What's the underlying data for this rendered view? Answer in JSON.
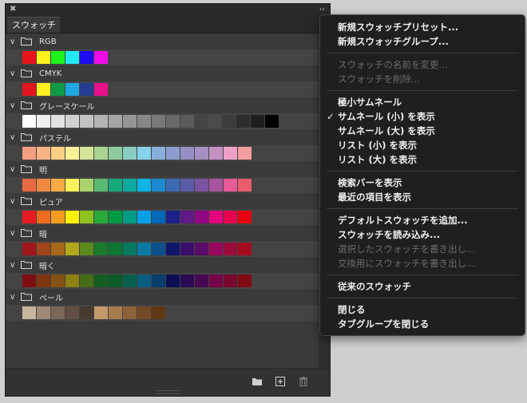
{
  "panel": {
    "tab_label": "スウォッチ",
    "close_glyph": "✖",
    "collapse_glyph": "‹‹"
  },
  "groups": [
    {
      "name": "RGB",
      "colors": [
        "#e8141b",
        "#fff21c",
        "#1ef21c",
        "#20e8f5",
        "#1d0cf0",
        "#f00ce8"
      ]
    },
    {
      "name": "CMYK",
      "colors": [
        "#e2161d",
        "#fff022",
        "#0d9a45",
        "#1ea6e1",
        "#253d91",
        "#e6108b"
      ]
    },
    {
      "name": "グレースケール",
      "colors": [
        "#ffffff",
        "#f0f0f0",
        "#e1e1e1",
        "#d2d2d2",
        "#c3c3c3",
        "#b4b4b4",
        "#a5a5a5",
        "#969696",
        "#878787",
        "#787878",
        "#696969",
        "#5a5a5a",
        "#4b4b4b",
        "#3c3c3c",
        "#2d2d2d",
        "#1e1e1e",
        "#000000"
      ]
    },
    {
      "name": "パステル",
      "colors": [
        "#f2a081",
        "#f6b483",
        "#fbd085",
        "#fdf197",
        "#d3e597",
        "#aad492",
        "#8fcb9c",
        "#8bcdc0",
        "#87d2ea",
        "#88afdc",
        "#8b9ccd",
        "#9490c3",
        "#a58fc2",
        "#c392c1",
        "#eea0c6",
        "#f19e9c"
      ]
    },
    {
      "name": "明",
      "colors": [
        "#e96a42",
        "#f08a43",
        "#f6ab45",
        "#fff25c",
        "#a9d36c",
        "#5bba72",
        "#17a77c",
        "#0ca99e",
        "#0bb2e3",
        "#1d8ad0",
        "#3c6ab3",
        "#5b5aa6",
        "#7a53a0",
        "#a7559f",
        "#e75b99",
        "#ea5e6b"
      ]
    },
    {
      "name": "ピュア",
      "colors": [
        "#e51d22",
        "#ee6c1e",
        "#f39d1e",
        "#fff100",
        "#8fc31f",
        "#2aa839",
        "#009944",
        "#009b84",
        "#00a0e9",
        "#0068b7",
        "#1d2088",
        "#601986",
        "#920783",
        "#e4007f",
        "#e5004f",
        "#e60012"
      ]
    },
    {
      "name": "暗",
      "colors": [
        "#a1171b",
        "#a1461a",
        "#a7681c",
        "#b2a71a",
        "#5c8a1f",
        "#1a7a2e",
        "#0d7732",
        "#06795f",
        "#0a7aa6",
        "#0c4f8b",
        "#10166c",
        "#3a0f6c",
        "#5b0b69",
        "#99065d",
        "#9b0a3c",
        "#a50c1b"
      ]
    },
    {
      "name": "暗く",
      "colors": [
        "#7e0e12",
        "#7e3510",
        "#825212",
        "#8b8211",
        "#456b16",
        "#135f22",
        "#0a5d26",
        "#065f4a",
        "#085e80",
        "#093d6c",
        "#0b1054",
        "#2c0b54",
        "#470853",
        "#770449",
        "#780830",
        "#810a13"
      ]
    },
    {
      "name": "ペール",
      "colors": [
        "#c6b69d",
        "#9e8a76",
        "#7b6758",
        "#614f43",
        "#463a31",
        "#c49a6c",
        "#a97c50",
        "#8e6239",
        "#744a24",
        "#603913"
      ]
    }
  ],
  "menu": {
    "items": [
      {
        "label": "新規スウォッチプリセット...",
        "disabled": false,
        "checked": false
      },
      {
        "label": "新規スウォッチグループ...",
        "disabled": false,
        "checked": false
      },
      {
        "sep": true
      },
      {
        "label": "スウォッチの名前を変更...",
        "disabled": true,
        "checked": false
      },
      {
        "label": "スウォッチを削除...",
        "disabled": true,
        "checked": false
      },
      {
        "sep": true
      },
      {
        "label": "極小サムネール",
        "disabled": false,
        "checked": false
      },
      {
        "label": "サムネール (小) を表示",
        "disabled": false,
        "checked": true
      },
      {
        "label": "サムネール (大) を表示",
        "disabled": false,
        "checked": false
      },
      {
        "label": "リスト (小) を表示",
        "disabled": false,
        "checked": false
      },
      {
        "label": "リスト (大) を表示",
        "disabled": false,
        "checked": false
      },
      {
        "sep": true
      },
      {
        "label": "検索バーを表示",
        "disabled": false,
        "checked": false
      },
      {
        "label": "最近の項目を表示",
        "disabled": false,
        "checked": false
      },
      {
        "sep": true
      },
      {
        "label": "デフォルトスウォッチを追加...",
        "disabled": false,
        "checked": false
      },
      {
        "label": "スウォッチを読み込み...",
        "disabled": false,
        "checked": false
      },
      {
        "label": "選択したスウォッチを書き出し...",
        "disabled": true,
        "checked": false
      },
      {
        "label": "交換用にスウォッチを書き出し...",
        "disabled": true,
        "checked": false
      },
      {
        "sep": true
      },
      {
        "label": "従来のスウォッチ",
        "disabled": false,
        "checked": false
      },
      {
        "sep": true
      },
      {
        "label": "閉じる",
        "disabled": false,
        "checked": false
      },
      {
        "label": "タブグループを閉じる",
        "disabled": false,
        "checked": false
      }
    ],
    "check_glyph": "✓"
  },
  "colors": {
    "panel_bg": "#323232",
    "content_bg": "#3a3a3a",
    "row_bg": "#444444",
    "menu_bg": "#1f1f1f",
    "menu_text": "#f0f0f0",
    "menu_disabled": "#6c6c6c"
  },
  "icons": [
    "close-icon",
    "collapse-icon",
    "panel-menu-icon",
    "chevron-down-icon",
    "folder-icon",
    "new-group-icon",
    "new-swatch-icon",
    "trash-icon"
  ]
}
